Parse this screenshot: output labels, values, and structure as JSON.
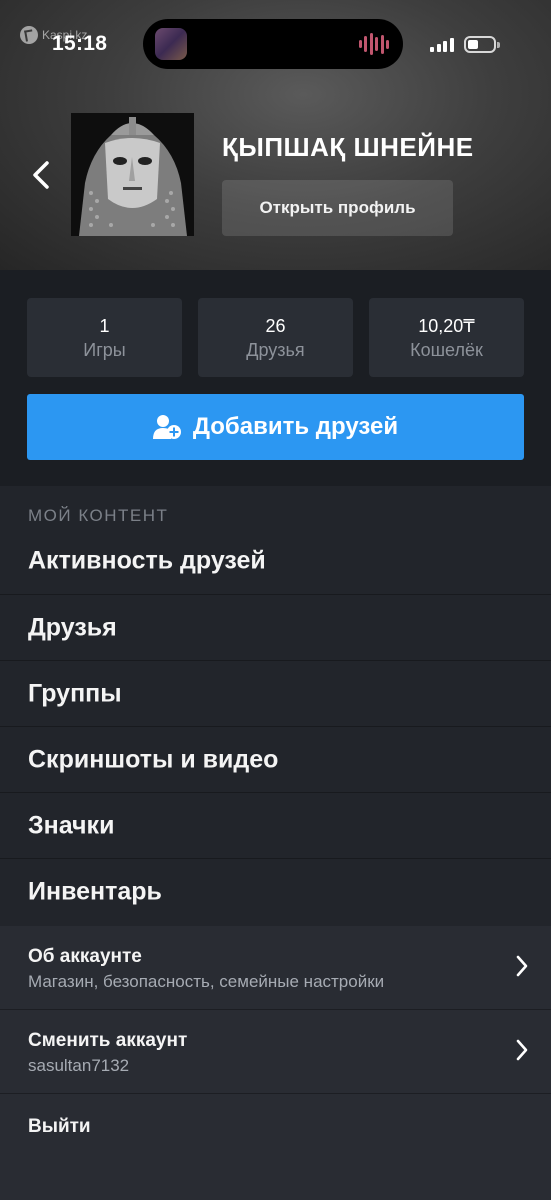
{
  "status_bar": {
    "back_app": "Kaspi.kz",
    "time": "15:18"
  },
  "profile": {
    "name": "ҚЫПШАҚ ШНЕЙНЕ",
    "open_profile_label": "Открыть профиль"
  },
  "stats": [
    {
      "value": "1",
      "label": "Игры"
    },
    {
      "value": "26",
      "label": "Друзья"
    },
    {
      "value": "10,20₸",
      "label": "Кошелёк"
    }
  ],
  "add_friends_label": "Добавить друзей",
  "my_content": {
    "title": "МОЙ КОНТЕНТ",
    "items": [
      "Активность друзей",
      "Друзья",
      "Группы",
      "Скриншоты и видео",
      "Значки",
      "Инвентарь"
    ]
  },
  "account": {
    "about_title": "Об аккаунте",
    "about_subtitle": "Магазин, безопасность, семейные настройки",
    "switch_title": "Сменить аккаунт",
    "switch_subtitle": "sasultan7132",
    "logout_label": "Выйти"
  },
  "colors": {
    "accent_button": "#2c97f2",
    "card_background": "#2a2e35",
    "page_background": "#22252b"
  }
}
